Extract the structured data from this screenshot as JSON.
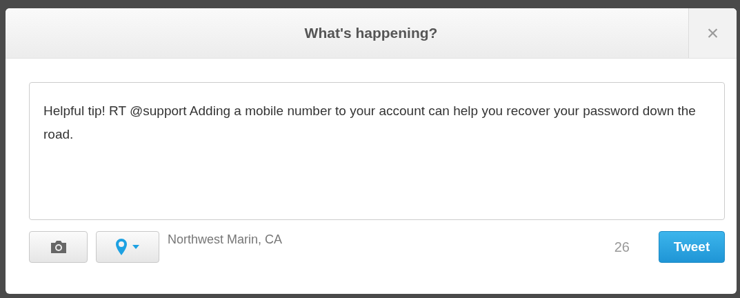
{
  "dialog": {
    "title": "What's happening?",
    "close": "×"
  },
  "composer": {
    "value": "Helpful tip! RT @support Adding a mobile number to your account can help you recover your password down the road."
  },
  "toolbar": {
    "location": "Northwest Marin, CA",
    "counter": "26",
    "submit": "Tweet"
  }
}
